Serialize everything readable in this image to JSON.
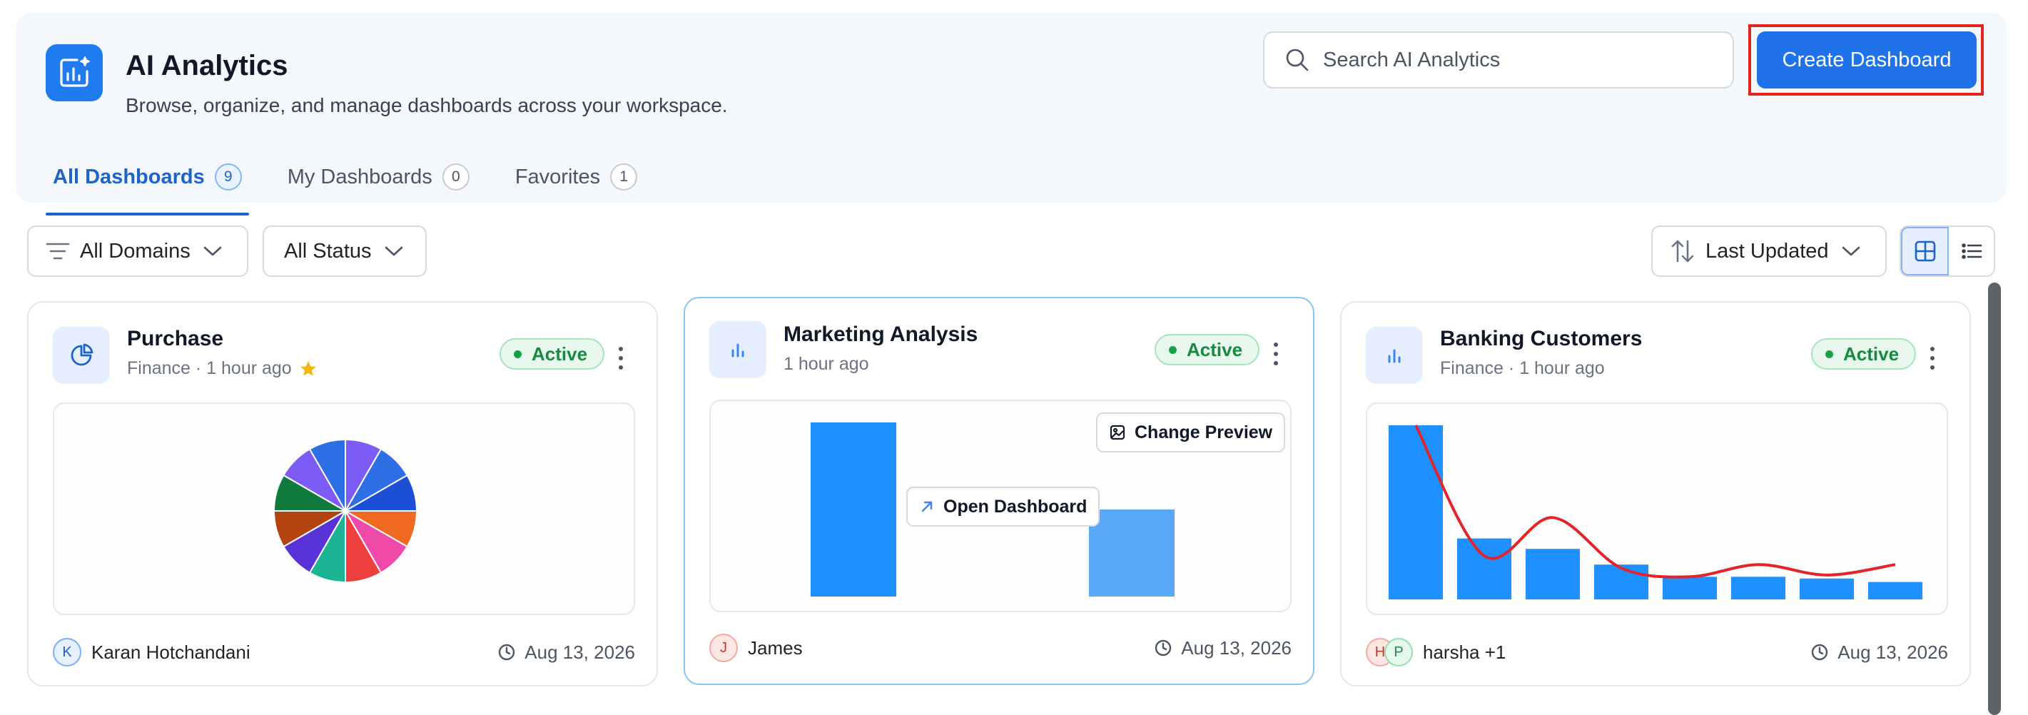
{
  "header": {
    "title": "AI Analytics",
    "subtitle": "Browse, organize, and manage dashboards across your workspace.",
    "search_placeholder": "Search AI Analytics",
    "create_button": "Create Dashboard"
  },
  "tabs": [
    {
      "label": "All Dashboards",
      "count": "9",
      "active": true
    },
    {
      "label": "My Dashboards",
      "count": "0",
      "active": false
    },
    {
      "label": "Favorites",
      "count": "1",
      "active": false
    }
  ],
  "filters": {
    "domains": "All Domains",
    "status": "All Status",
    "sort": "Last Updated",
    "view": "grid"
  },
  "cards": [
    {
      "title": "Purchase",
      "meta": "Finance · 1 hour ago",
      "favorite": true,
      "status": "Active",
      "owner": "Karan Hotchandani",
      "owner_initials": [
        "K"
      ],
      "updated": "Aug 13, 2026",
      "icon": "pie-chart-icon",
      "chart_data": {
        "type": "pie",
        "values": [
          1,
          1,
          1,
          1,
          1,
          1,
          1,
          1,
          1,
          1,
          1,
          1
        ],
        "colors": [
          "#7c5cf5",
          "#2f6fe6",
          "#1d4fd6",
          "#f06a22",
          "#ef4aa8",
          "#ee3f3f",
          "#1bb595",
          "#5932d8",
          "#b3430f",
          "#0e7a3e",
          "#7c5cf5",
          "#2f6fe6"
        ]
      }
    },
    {
      "title": "Marketing Analysis",
      "meta": "1 hour ago",
      "favorite": false,
      "status": "Active",
      "owner": "James",
      "owner_initials": [
        "J"
      ],
      "updated": "Aug 13, 2026",
      "icon": "bar-chart-icon",
      "overlay": {
        "change_preview": "Change Preview",
        "open_dashboard": "Open Dashboard"
      },
      "chart_data": {
        "type": "bar",
        "values": [
          100,
          0,
          0,
          50
        ],
        "colors": [
          "#1e90ff",
          "#1e90ff",
          "#1e90ff",
          "#5aa9f8"
        ]
      }
    },
    {
      "title": "Banking Customers",
      "meta": "Finance · 1 hour ago",
      "favorite": false,
      "status": "Active",
      "owner": "harsha +1",
      "owner_initials": [
        "H",
        "P"
      ],
      "updated": "Aug 13, 2026",
      "icon": "bar-chart-icon",
      "chart_data": {
        "type": "bar",
        "values": [
          100,
          35,
          29,
          20,
          13,
          13,
          12,
          10
        ],
        "line": [
          100,
          25,
          47,
          18,
          13,
          20,
          14,
          20
        ],
        "bar_color": "#1e90ff",
        "line_color": "#e3242b"
      }
    }
  ]
}
